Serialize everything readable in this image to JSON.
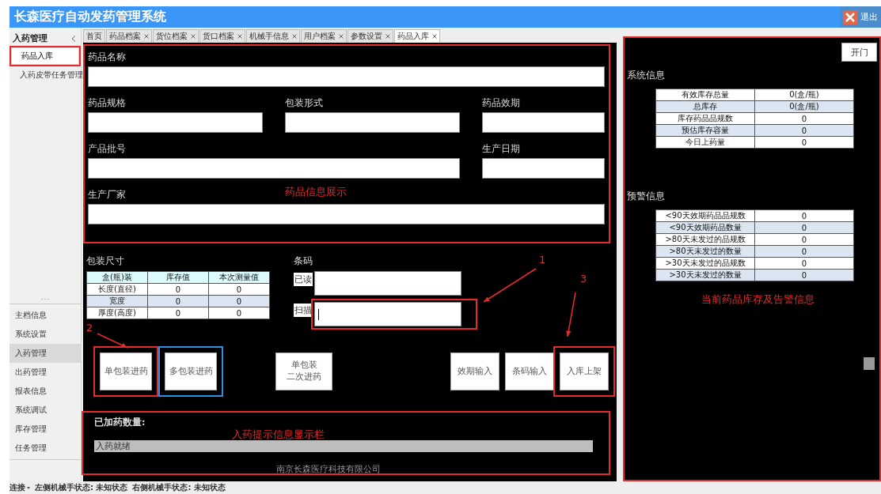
{
  "window": {
    "title": "长森医疗自动发药管理系统",
    "exit_button": "退出"
  },
  "sidebar": {
    "header": "入药管理",
    "sub_items": [
      {
        "label": "药品入库",
        "selected": true,
        "color": "#e52b2b"
      },
      {
        "label": "入药皮带任务管理",
        "selected": false
      }
    ],
    "menu": [
      {
        "label": "主档信息",
        "selected": false
      },
      {
        "label": "系统设置",
        "selected": false
      },
      {
        "label": "入药管理",
        "selected": true
      },
      {
        "label": "出药管理",
        "selected": false
      },
      {
        "label": "报表信息",
        "selected": false
      },
      {
        "label": "系统调试",
        "selected": false
      },
      {
        "label": "库存管理",
        "selected": false
      },
      {
        "label": "任务管理",
        "selected": false
      }
    ]
  },
  "tabs": [
    {
      "label": "首页",
      "selected": false,
      "closable": false
    },
    {
      "label": "药品档案",
      "selected": false,
      "closable": true
    },
    {
      "label": "货位档案",
      "selected": false,
      "closable": true
    },
    {
      "label": "货口档案",
      "selected": false,
      "closable": true
    },
    {
      "label": "机械手信息",
      "selected": false,
      "closable": true
    },
    {
      "label": "用户档案",
      "selected": false,
      "closable": true
    },
    {
      "label": "参数设置",
      "selected": false,
      "closable": true
    },
    {
      "label": "药品入库",
      "selected": true,
      "closable": true
    }
  ],
  "drug_info": {
    "color": "#e52b2b",
    "caption": "药品信息展示",
    "fields": [
      {
        "label": "药品名称",
        "kind": "full"
      },
      {
        "label": "药品规格",
        "kind": "single"
      },
      {
        "label": "包装形式",
        "kind": "single"
      },
      {
        "label": "药品效期",
        "kind": "single"
      },
      {
        "label": "产品批号",
        "kind": "double"
      },
      {
        "label": "生产日期",
        "kind": "single"
      },
      {
        "label": "生产厂家",
        "kind": "full"
      }
    ]
  },
  "package_size": {
    "title": "包装尺寸",
    "columns": [
      "盒(瓶)装",
      "库存值",
      "本次测量值"
    ],
    "rows": [
      [
        "长度(直径)",
        "0",
        "0"
      ],
      [
        "宽度",
        "0",
        "0"
      ],
      [
        "厚度(高度)",
        "0",
        "0"
      ]
    ]
  },
  "barcode": {
    "title": "条码",
    "fields": [
      {
        "label": "已读",
        "focused": false
      },
      {
        "label": "扫描",
        "focused": true,
        "color": "#e52b2b"
      }
    ]
  },
  "action_groups": [
    [
      {
        "lines": [
          "单包装进药"
        ],
        "color": "#e52b2b"
      },
      {
        "lines": [
          "多包装进药"
        ],
        "color": "#2f8fe0"
      }
    ],
    [
      {
        "lines": [
          "单包装",
          "二次进药"
        ]
      }
    ],
    [
      {
        "lines": [
          "效期输入"
        ]
      },
      {
        "lines": [
          "条码输入"
        ]
      },
      {
        "lines": [
          "入库上架"
        ],
        "color": "#e52b2b"
      }
    ]
  ],
  "status_panel": {
    "color": "#e52b2b",
    "count_label": "已加药数量:",
    "caption": "入药提示信息显示栏",
    "message": "入药就绪",
    "footer": "南京长森医疗科技有限公司"
  },
  "right_panel": {
    "color": "#e52b2b",
    "door_button": "开门",
    "system_info": {
      "title": "系统信息",
      "rows": [
        [
          "有效库存总量",
          "0(盒/瓶)"
        ],
        [
          "总库存",
          "0(盒/瓶)"
        ],
        [
          "库存药品品规数",
          "0"
        ],
        [
          "预估库存容量",
          "0"
        ],
        [
          "今日上药量",
          "0"
        ]
      ]
    },
    "warning_info": {
      "title": "预警信息",
      "rows": [
        [
          "<90天效期药品品规数",
          "0"
        ],
        [
          "<90天效期药品数量",
          "0"
        ],
        [
          ">80天未发过的品规数",
          "0"
        ],
        [
          ">80天未发过的数量",
          "0"
        ],
        [
          ">30天未发过的品规数",
          "0"
        ],
        [
          ">30天未发过的数量",
          "0"
        ]
      ]
    },
    "caption": "当前药品库存及告警信息"
  },
  "annotation_marks": [
    "1",
    "2",
    "3"
  ],
  "status_bar": {
    "connection": "连接",
    "items": [
      "左侧机械手状态: 未知状态",
      "右侧机械手状态: 未知状态"
    ]
  }
}
